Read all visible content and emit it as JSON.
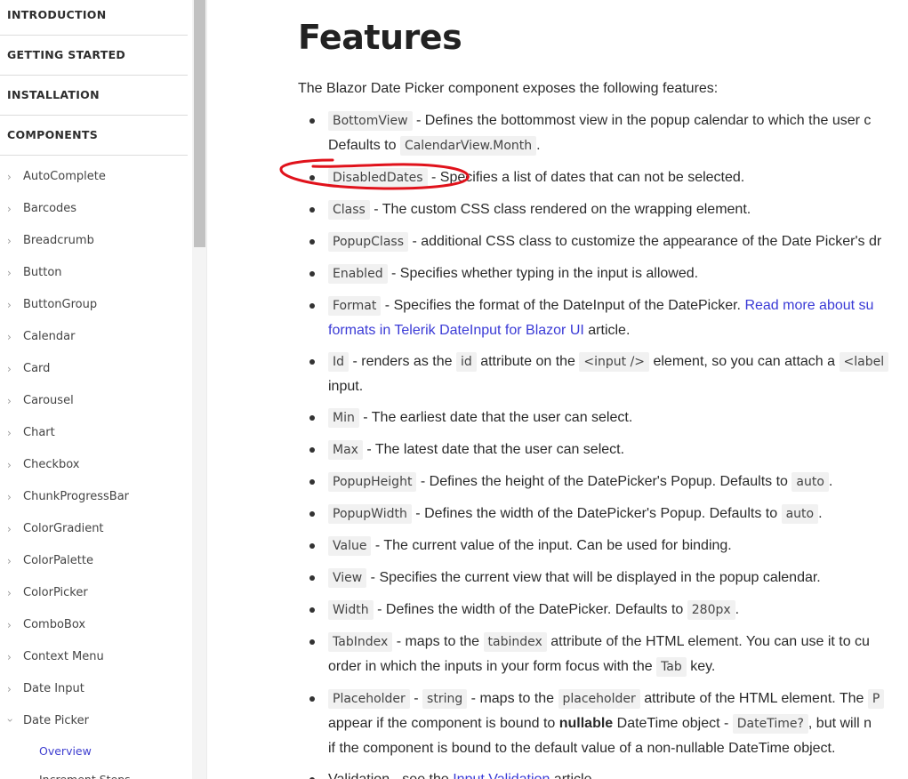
{
  "sidebar": {
    "sections": [
      "INTRODUCTION",
      "GETTING STARTED",
      "INSTALLATION",
      "COMPONENTS"
    ],
    "components": [
      "AutoComplete",
      "Barcodes",
      "Breadcrumb",
      "Button",
      "ButtonGroup",
      "Calendar",
      "Card",
      "Carousel",
      "Chart",
      "Checkbox",
      "ChunkProgressBar",
      "ColorGradient",
      "ColorPalette",
      "ColorPicker",
      "ComboBox",
      "Context Menu",
      "Date Input",
      "Date Picker"
    ],
    "sub_items": [
      "Overview",
      "Increment Steps"
    ],
    "active_sub_item": "Overview",
    "expanded_component": "Date Picker"
  },
  "content": {
    "title": "Features",
    "intro": "The Blazor Date Picker component exposes the following features:",
    "features": {
      "f1": {
        "code": "BottomView",
        "text": " - Defines the bottommost view in the popup calendar to which the user c",
        "code2": "CalendarView.Month",
        "text_l2a": "Defaults to ",
        "text_l2b": "."
      },
      "f2": {
        "code": "DisabledDates",
        "text": " - Specifies a list of dates that can not be selected."
      },
      "f3": {
        "code": "Class",
        "text": " - The custom CSS class rendered on the wrapping element."
      },
      "f4": {
        "code": "PopupClass",
        "text": " - additional CSS class to customize the appearance of the Date Picker's dr"
      },
      "f5": {
        "code": "Enabled",
        "text": " - Specifies whether typing in the input is allowed."
      },
      "f6": {
        "code": "Format",
        "text": " - Specifies the format of the DateInput of the DatePicker. ",
        "link": "Read more about su",
        "link_l2": "formats in Telerik DateInput for Blazor UI",
        "text_l2": " article."
      },
      "f7": {
        "code": "Id",
        "text": " - renders as the ",
        "code2": "id",
        "text2": " attribute on the ",
        "code3": "<input />",
        "text3": " element, so you can attach a ",
        "code4": "<label",
        "text_l2": "input."
      },
      "f8": {
        "code": "Min",
        "text": " - The earliest date that the user can select."
      },
      "f9": {
        "code": "Max",
        "text": " - The latest date that the user can select."
      },
      "f10": {
        "code": "PopupHeight",
        "text": " - Defines the height of the DatePicker's Popup. Defaults to ",
        "code2": "auto",
        "text2": "."
      },
      "f11": {
        "code": "PopupWidth",
        "text": " - Defines the width of the DatePicker's Popup. Defaults to ",
        "code2": "auto",
        "text2": "."
      },
      "f12": {
        "code": "Value",
        "text": " - The current value of the input. Can be used for binding."
      },
      "f13": {
        "code": "View",
        "text": " - Specifies the current view that will be displayed in the popup calendar."
      },
      "f14": {
        "code": "Width",
        "text": " - Defines the width of the DatePicker. Defaults to ",
        "code2": "280px",
        "text2": "."
      },
      "f15": {
        "code": "TabIndex",
        "text": " - maps to the ",
        "code2": "tabindex",
        "text2": " attribute of the HTML element. You can use it to cu",
        "text_l2a": "order in which the inputs in your form focus with the ",
        "code3": "Tab",
        "text_l2b": " key."
      },
      "f16": {
        "code": "Placeholder",
        "text": " - ",
        "code2": "string",
        "text2": " - maps to the ",
        "code3": "placeholder",
        "text3": " attribute of the HTML element. The ",
        "code4": "P",
        "text_l2a": "appear if the component is bound to ",
        "bold": "nullable",
        "text_l2b": " DateTime object - ",
        "code5": "DateTime?",
        "text_l2c": ", but will n",
        "text_l3": "if the component is bound to the default value of a non-nullable DateTime object."
      },
      "f17": {
        "text": "Validation - see the ",
        "link": "Input Validation",
        "text2": " article."
      }
    }
  },
  "colors": {
    "link": "#3a3ad6",
    "active_nav": "#3f3fd0",
    "annotation": "#e0121b",
    "code_bg": "#f1f1f1"
  }
}
